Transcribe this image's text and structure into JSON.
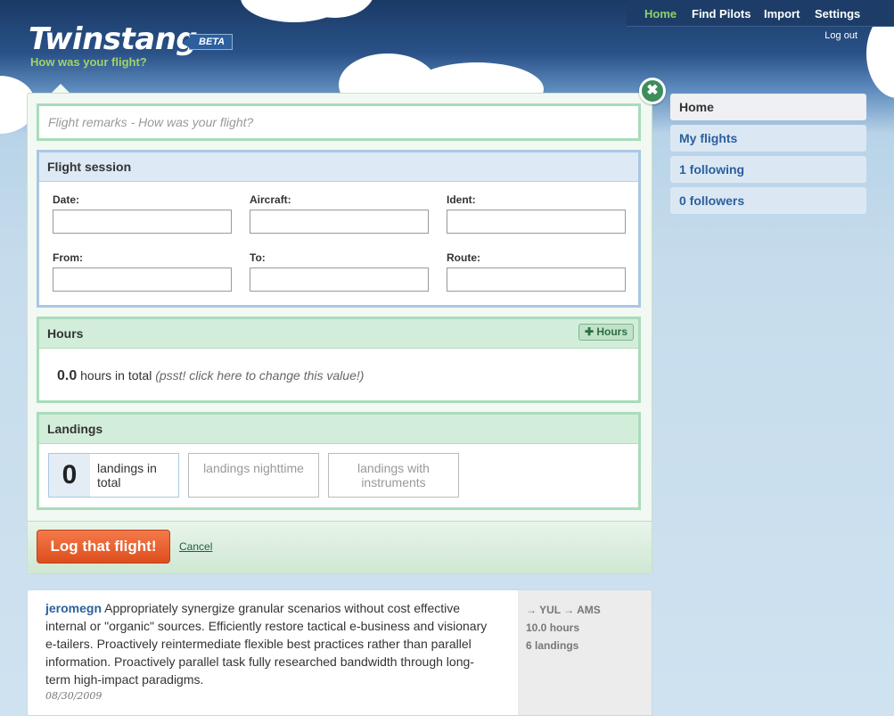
{
  "header": {
    "logo": "Twinstang",
    "badge": "BETA",
    "tagline": "How was your flight?"
  },
  "topnav": {
    "items": [
      "Home",
      "Find Pilots",
      "Import",
      "Settings"
    ],
    "logout": "Log out"
  },
  "form": {
    "remarks_placeholder": "Flight remarks - How was your flight?",
    "close_symbol": "✖",
    "flight_session": {
      "title": "Flight session",
      "fields": [
        "Date:",
        "Aircraft:",
        "Ident:",
        "From:",
        "To:",
        "Route:"
      ]
    },
    "hours": {
      "title": "Hours",
      "add_label": "✚ Hours",
      "value": "0.0",
      "unit_text": " hours in total ",
      "hint": "(psst! click here to change this value!)"
    },
    "landings": {
      "title": "Landings",
      "total_value": "0",
      "total_label": "landings in total",
      "night_label": "landings nighttime",
      "instrument_label": "landings with instruments"
    },
    "submit_label": "Log that flight!",
    "cancel_label": "Cancel"
  },
  "feed": {
    "user": "jeromegn",
    "text": " Appropriately synergize granular scenarios without cost effective internal or \"organic\" sources. Efficiently restore tactical e-business and visionary e-tailers. Proactively reintermediate flexible best practices rather than parallel information. Proactively parallel task fully researched bandwidth through long-term high-impact paradigms.",
    "date": "08/30/2009",
    "route": "→ YUL → AMS",
    "hours": "10.0 hours",
    "landings": "6 landings"
  },
  "sidenav": {
    "items": [
      "Home",
      "My flights",
      "1 following",
      "0 followers"
    ]
  },
  "colors": {
    "accent_green": "#a9dcbb",
    "accent_blue": "#a9c8e2",
    "submit_orange": "#dd4e1c",
    "link_blue": "#2b5f9e",
    "tagline_green": "#9fd36a"
  }
}
